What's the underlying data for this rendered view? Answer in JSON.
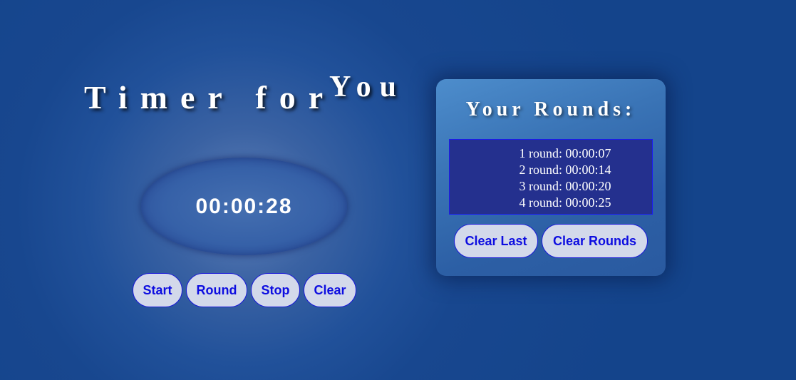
{
  "header": {
    "title": "Timer for",
    "title_sup": "You"
  },
  "timer": {
    "display": "00:00:28"
  },
  "controls": {
    "start_label": "Start",
    "round_label": "Round",
    "stop_label": "Stop",
    "clear_label": "Clear"
  },
  "rounds": {
    "title": "Your Rounds:",
    "items": [
      "1 round: 00:00:07",
      "2 round: 00:00:14",
      "3 round: 00:00:20",
      "4 round: 00:00:25"
    ],
    "clear_last_label": "Clear Last",
    "clear_rounds_label": "Clear Rounds"
  },
  "colors": {
    "background": "#1b4a8f",
    "button_bg": "#d3d9ea",
    "button_text": "#0d0de0",
    "rounds_list_bg": "#24308e"
  }
}
